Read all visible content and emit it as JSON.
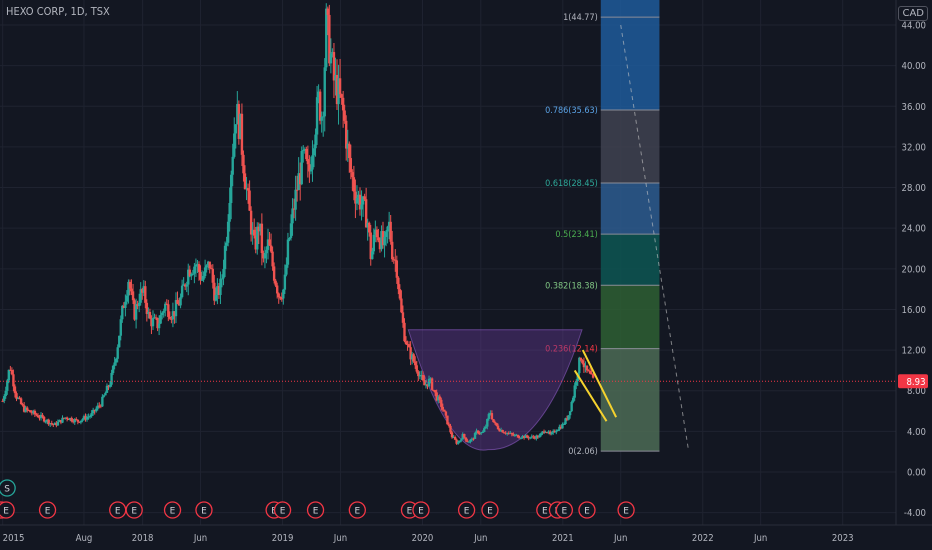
{
  "header": {
    "symbol": "HEXO CORP",
    "interval": "1D",
    "exchange": "TSX",
    "title": "HEXO CORP, 1D, TSX",
    "currency": "CAD"
  },
  "colors": {
    "background": "#131722",
    "grid": "#1f2330",
    "up": "#26a69a",
    "down": "#ef5350",
    "accent_price": "#f23645",
    "cup": "#6a3d9a",
    "trend": "#f5d22e"
  },
  "chart_data": {
    "type": "candlestick",
    "title": "HEXO CORP, 1D, TSX",
    "ylabel": "CAD",
    "ylim": [
      -5,
      45
    ],
    "y_ticks": [
      "44.00",
      "40.00",
      "36.00",
      "32.00",
      "28.00",
      "24.00",
      "20.00",
      "16.00",
      "12.00",
      "8.00",
      "4.00",
      "0.00",
      "-4.00"
    ],
    "y_tick_values": [
      44,
      40,
      36,
      32,
      28,
      24,
      20,
      16,
      12,
      8,
      4,
      0,
      -4
    ],
    "x_ticks": [
      "2015",
      "Aug",
      "2018",
      "Jun",
      "2019",
      "Jun",
      "2020",
      "Jun",
      "2021",
      "Jun",
      "2022",
      "Jun",
      "2023"
    ],
    "x_tick_dates": [
      "2017-01-01",
      "2017-08-01",
      "2018-01-01",
      "2018-06-01",
      "2019-01-01",
      "2019-06-01",
      "2020-01-01",
      "2020-06-01",
      "2021-01-01",
      "2021-06-01",
      "2022-01-01",
      "2022-06-01",
      "2023-01-01"
    ],
    "x_range": [
      "2016-12-25",
      "2023-05-20"
    ],
    "current_price": {
      "value": 8.93,
      "label": "8.93"
    },
    "price_path": [
      [
        "2017-01-01",
        7.0
      ],
      [
        "2017-01-10",
        8.5
      ],
      [
        "2017-01-20",
        10.5
      ],
      [
        "2017-02-05",
        7.5
      ],
      [
        "2017-02-25",
        6.2
      ],
      [
        "2017-03-20",
        5.8
      ],
      [
        "2017-04-20",
        5.2
      ],
      [
        "2017-05-15",
        4.6
      ],
      [
        "2017-06-15",
        5.4
      ],
      [
        "2017-07-15",
        5.0
      ],
      [
        "2017-08-20",
        5.6
      ],
      [
        "2017-09-15",
        6.8
      ],
      [
        "2017-10-10",
        9.0
      ],
      [
        "2017-10-25",
        11.8
      ],
      [
        "2017-11-10",
        16.0
      ],
      [
        "2017-11-25",
        19.0
      ],
      [
        "2017-12-10",
        15.5
      ],
      [
        "2017-12-25",
        17.5
      ],
      [
        "2018-01-05",
        17.5
      ],
      [
        "2018-01-18",
        15.0
      ],
      [
        "2018-02-10",
        14.5
      ],
      [
        "2018-02-28",
        16.5
      ],
      [
        "2018-03-20",
        15.5
      ],
      [
        "2018-04-10",
        17.0
      ],
      [
        "2018-05-01",
        20.0
      ],
      [
        "2018-05-20",
        20.5
      ],
      [
        "2018-06-05",
        19.0
      ],
      [
        "2018-06-25",
        20.5
      ],
      [
        "2018-07-10",
        17.0
      ],
      [
        "2018-07-25",
        18.5
      ],
      [
        "2018-08-08",
        23.5
      ],
      [
        "2018-08-20",
        30.0
      ],
      [
        "2018-09-01",
        35.5
      ],
      [
        "2018-09-12",
        34.0
      ],
      [
        "2018-09-25",
        29.0
      ],
      [
        "2018-10-08",
        25.0
      ],
      [
        "2018-10-20",
        22.0
      ],
      [
        "2018-11-01",
        24.5
      ],
      [
        "2018-11-12",
        20.5
      ],
      [
        "2018-11-25",
        22.5
      ],
      [
        "2018-12-10",
        19.5
      ],
      [
        "2018-12-22",
        17.5
      ],
      [
        "2019-01-05",
        18.0
      ],
      [
        "2019-01-15",
        22.0
      ],
      [
        "2019-01-28",
        25.5
      ],
      [
        "2019-02-10",
        28.5
      ],
      [
        "2019-02-25",
        31.0
      ],
      [
        "2019-03-10",
        29.0
      ],
      [
        "2019-03-22",
        33.0
      ],
      [
        "2019-04-05",
        36.5
      ],
      [
        "2019-04-15",
        35.0
      ],
      [
        "2019-04-25",
        44.0
      ],
      [
        "2019-05-05",
        41.5
      ],
      [
        "2019-05-15",
        38.5
      ],
      [
        "2019-05-25",
        37.5
      ],
      [
        "2019-06-10",
        35.0
      ],
      [
        "2019-06-25",
        30.0
      ],
      [
        "2019-07-10",
        27.5
      ],
      [
        "2019-07-25",
        26.5
      ],
      [
        "2019-08-10",
        25.0
      ],
      [
        "2019-08-20",
        21.0
      ],
      [
        "2019-09-01",
        24.0
      ],
      [
        "2019-09-12",
        23.0
      ],
      [
        "2019-09-25",
        22.0
      ],
      [
        "2019-10-05",
        24.5
      ],
      [
        "2019-10-15",
        21.5
      ],
      [
        "2019-10-25",
        20.5
      ],
      [
        "2019-11-05",
        16.0
      ],
      [
        "2019-11-15",
        13.5
      ],
      [
        "2019-11-25",
        12.0
      ],
      [
        "2019-12-08",
        11.0
      ],
      [
        "2019-12-20",
        10.0
      ],
      [
        "2020-01-05",
        8.5
      ],
      [
        "2020-01-20",
        9.0
      ],
      [
        "2020-02-05",
        7.5
      ],
      [
        "2020-02-20",
        6.5
      ],
      [
        "2020-03-05",
        5.0
      ],
      [
        "2020-03-18",
        3.5
      ],
      [
        "2020-04-01",
        2.8
      ],
      [
        "2020-04-15",
        3.6
      ],
      [
        "2020-04-28",
        3.0
      ],
      [
        "2020-05-10",
        3.2
      ],
      [
        "2020-05-22",
        4.0
      ],
      [
        "2020-06-05",
        3.8
      ],
      [
        "2020-06-15",
        4.6
      ],
      [
        "2020-06-25",
        6.0
      ],
      [
        "2020-07-05",
        4.8
      ],
      [
        "2020-07-20",
        4.2
      ],
      [
        "2020-08-05",
        3.9
      ],
      [
        "2020-08-25",
        3.6
      ],
      [
        "2020-09-15",
        3.5
      ],
      [
        "2020-10-10",
        3.4
      ],
      [
        "2020-11-01",
        3.5
      ],
      [
        "2020-11-15",
        4.2
      ],
      [
        "2020-11-30",
        3.6
      ],
      [
        "2020-12-15",
        4.2
      ],
      [
        "2020-12-31",
        4.6
      ],
      [
        "2021-01-15",
        5.5
      ],
      [
        "2021-01-28",
        7.5
      ],
      [
        "2021-02-08",
        10.0
      ],
      [
        "2021-02-18",
        11.5
      ],
      [
        "2021-03-01",
        10.0
      ],
      [
        "2021-03-12",
        9.5
      ],
      [
        "2021-03-22",
        8.93
      ]
    ],
    "fib_retracement": {
      "start_date": "2021-04-10",
      "end_date": "2021-09-10",
      "levels": [
        {
          "ratio": 1,
          "value": 44.77,
          "label": "1(44.77)",
          "color": "#1e5a9a",
          "text_color": "#b2b5be"
        },
        {
          "ratio": 0.786,
          "value": 35.63,
          "label": "0.786(35.63)",
          "color": "#3f4250",
          "text_color": "#5ba3e6"
        },
        {
          "ratio": 0.618,
          "value": 28.45,
          "label": "0.618(28.45)",
          "color": "#2d5c8f",
          "text_color": "#2ea99a"
        },
        {
          "ratio": 0.5,
          "value": 23.41,
          "label": "0.5(23.41)",
          "color": "#0d5652",
          "text_color": "#4caf50"
        },
        {
          "ratio": 0.382,
          "value": 18.38,
          "label": "0.382(18.38)",
          "color": "#2e5f33",
          "text_color": "#81c784"
        },
        {
          "ratio": 0.236,
          "value": 12.14,
          "label": "0.236(12.14)",
          "color": "#4c6b55",
          "text_color": "#f23645"
        },
        {
          "ratio": 0,
          "value": 2.06,
          "label": "0(2.06)",
          "color": "#7f2a2c",
          "text_color": "#b2b5be"
        }
      ]
    },
    "cup_pattern": {
      "start_date": "2019-11-25",
      "bottom_date": "2020-06-20",
      "end_date": "2021-02-20",
      "rim_value": 14.0,
      "bottom_value": 2.2
    },
    "trend_lines": [
      {
        "from": [
          "2021-02-22",
          12.0
        ],
        "to": [
          "2021-05-20",
          5.4
        ]
      },
      {
        "from": [
          "2021-02-01",
          10.0
        ],
        "to": [
          "2021-04-25",
          5.0
        ]
      }
    ],
    "diagonal": {
      "from": [
        "2021-06-01",
        44.0
      ],
      "to": [
        "2021-11-25",
        2.1
      ]
    },
    "events": [
      {
        "date": "2016-12-28",
        "label": "E"
      },
      {
        "date": "2017-01-10",
        "label": "E"
      },
      {
        "date": "2017-04-28",
        "label": "E"
      },
      {
        "date": "2017-10-28",
        "label": "E"
      },
      {
        "date": "2017-12-10",
        "label": "E"
      },
      {
        "date": "2018-03-20",
        "label": "E"
      },
      {
        "date": "2018-06-10",
        "label": "E"
      },
      {
        "date": "2018-12-10",
        "label": "E"
      },
      {
        "date": "2019-01-01",
        "label": "E"
      },
      {
        "date": "2019-03-28",
        "label": "E"
      },
      {
        "date": "2019-07-15",
        "label": "E"
      },
      {
        "date": "2019-11-28",
        "label": "E"
      },
      {
        "date": "2019-12-28",
        "label": "E"
      },
      {
        "date": "2020-04-25",
        "label": "E"
      },
      {
        "date": "2020-06-25",
        "label": "E"
      },
      {
        "date": "2020-11-15",
        "label": "E"
      },
      {
        "date": "2020-12-18",
        "label": "E"
      },
      {
        "date": "2021-01-05",
        "label": "E"
      },
      {
        "date": "2021-03-05",
        "label": "E"
      },
      {
        "date": "2021-06-15",
        "label": "E"
      }
    ],
    "split": {
      "date": "2016-12-28",
      "label": "S"
    }
  }
}
